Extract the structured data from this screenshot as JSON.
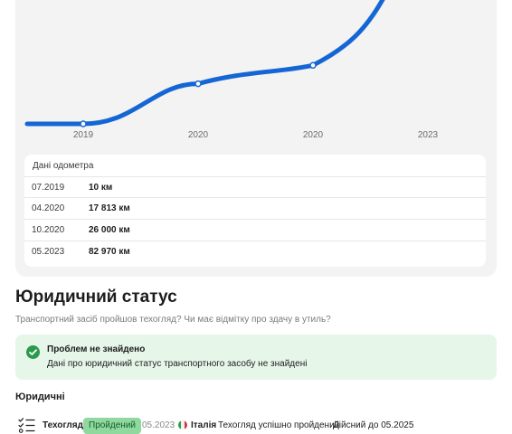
{
  "colors": {
    "line": "#1466d4",
    "card_bg": "#f3f3f3",
    "success_bg": "#e6f6e9",
    "success_icon": "#2a9a4b",
    "badge_bg": "#8fd99f",
    "badge_text": "#155c2a"
  },
  "chart_data": {
    "type": "line",
    "x_ticks": [
      "2019",
      "2020",
      "2020",
      "2023"
    ],
    "points": [
      {
        "date": "07.2019",
        "km": 10
      },
      {
        "date": "04.2020",
        "km": 17813
      },
      {
        "date": "10.2020",
        "km": 26000
      },
      {
        "date": "05.2023",
        "km": 82970
      }
    ],
    "ylim_visible": [
      0,
      55000
    ],
    "grid": false
  },
  "odometer": {
    "title": "Дані одометра",
    "rows": [
      {
        "date": "07.2019",
        "value": "10 км"
      },
      {
        "date": "04.2020",
        "value": "17 813 км"
      },
      {
        "date": "10.2020",
        "value": "26 000 км"
      },
      {
        "date": "05.2023",
        "value": "82 970 км"
      }
    ]
  },
  "legal": {
    "title": "Юридичний статус",
    "subtitle": "Транспортний засіб пройшов техогляд? Чи має відмітку про здачу в утиль?",
    "alert": {
      "icon": "check-icon",
      "title": "Проблем не знайдено",
      "text": "Дані про юридичний статус транспортного засобу не знайдені"
    },
    "section_title": "Юридичні"
  },
  "inspection": {
    "icon": "checklist-icon",
    "label": "Техогляд",
    "status": "Пройдений",
    "date": "05.2023",
    "flag_icon": "italy-flag-icon",
    "country": "Італія",
    "result": "Техогляд успішно пройдений",
    "valid_until": "Дійсний до 05.2025"
  }
}
